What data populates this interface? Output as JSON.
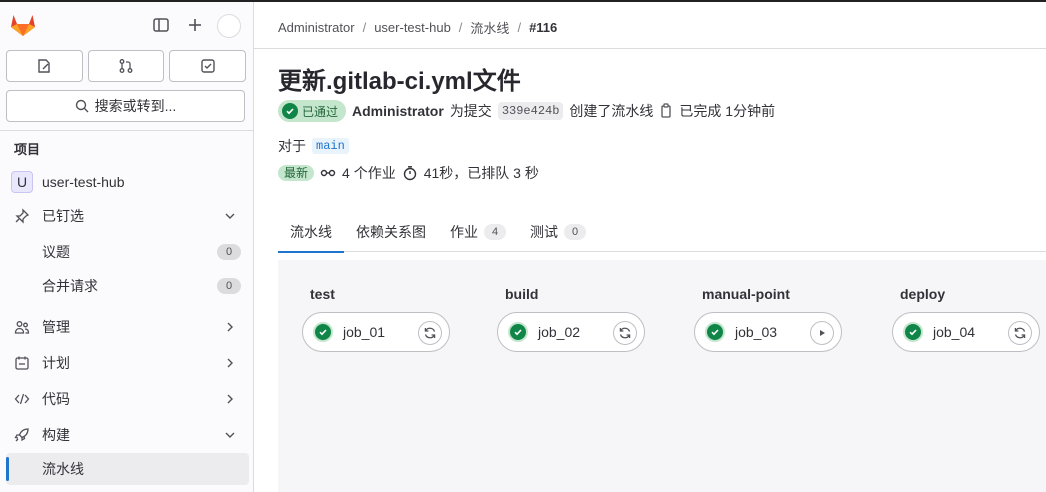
{
  "sidebar": {
    "section_title": "项目",
    "search_placeholder": "搜索或转到...",
    "project": {
      "initial": "U",
      "name": "user-test-hub"
    },
    "pinned": {
      "label": "已钉选",
      "items": [
        {
          "label": "议题",
          "count": "0"
        },
        {
          "label": "合并请求",
          "count": "0"
        }
      ]
    },
    "nav": [
      {
        "label": "管理"
      },
      {
        "label": "计划"
      },
      {
        "label": "代码"
      },
      {
        "label": "构建"
      }
    ],
    "build_sub": {
      "label": "流水线"
    }
  },
  "breadcrumb": {
    "items": [
      "Administrator",
      "user-test-hub",
      "流水线"
    ],
    "current": "#116"
  },
  "pipeline": {
    "title": "更新.gitlab-ci.yml文件",
    "status": "已通过",
    "author": "Administrator",
    "for_commit": "为提交",
    "sha": "339e424b",
    "created": "创建了流水线",
    "finished": "已完成 1分钟前",
    "for_label": "对于",
    "ref": "main",
    "latest_badge": "最新",
    "jobs_count": "4 个作业",
    "duration": "41秒，已排队 3 秒"
  },
  "tabs": [
    {
      "label": "流水线",
      "count": null,
      "active": true
    },
    {
      "label": "依赖关系图",
      "count": null,
      "active": false
    },
    {
      "label": "作业",
      "count": "4",
      "active": false
    },
    {
      "label": "测试",
      "count": "0",
      "active": false
    }
  ],
  "stages": [
    {
      "name": "test",
      "job": "job_01",
      "action": "retry-icon"
    },
    {
      "name": "build",
      "job": "job_02",
      "action": "retry-icon"
    },
    {
      "name": "manual-point",
      "job": "job_03",
      "action": "play-icon"
    },
    {
      "name": "deploy",
      "job": "job_04",
      "action": "retry-icon"
    }
  ],
  "colors": {
    "success": "#108548",
    "accent": "#1f75cb",
    "logo": "#e24329"
  }
}
